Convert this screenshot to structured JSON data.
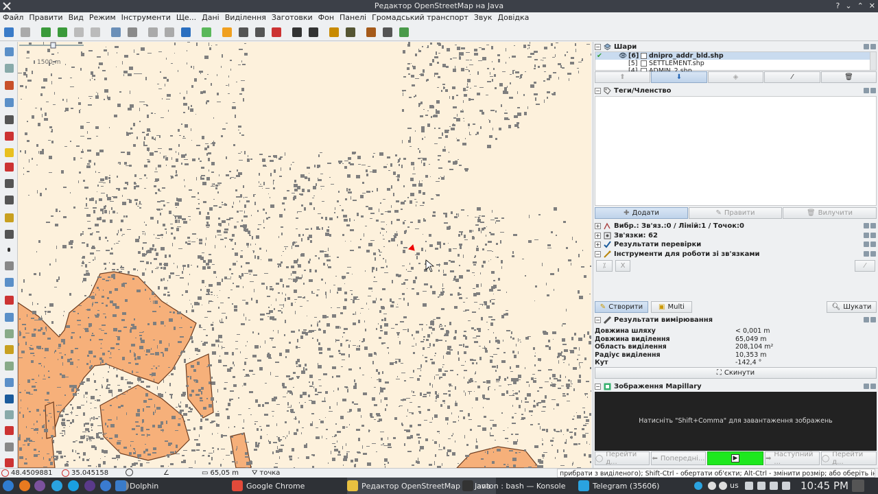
{
  "window": {
    "title": "Редактор OpenStreetMap на Java"
  },
  "menu": [
    "Файл",
    "Правити",
    "Вид",
    "Режим",
    "Інструменти",
    "Ще...",
    "Дані",
    "Виділення",
    "Заготовки",
    "Фон",
    "Панелі",
    "Громадський транспорт",
    "Звук",
    "Довідка"
  ],
  "colors": {
    "map_bg": "#fdf1dc",
    "building": "#7f7f7f",
    "settlement_fill": "#f6b07a",
    "settlement_stroke": "#6b3a1e",
    "panel_bg": "#eef0f2",
    "accent_green": "#1ee81e"
  },
  "toolbar_icons": [
    "open-icon",
    "save-icon",
    "download-icon",
    "upload-icon",
    "undo-icon",
    "redo-icon",
    "zoom-data-icon",
    "preferences-icon",
    "simplify-icon",
    "merge-icon",
    "refresh-icon",
    "bbox-icon",
    "preset-1-icon",
    "preset-2-icon",
    "preset-3-icon",
    "preset-4-icon",
    "car-icon",
    "bus-icon",
    "warning-icon",
    "restaurant-icon",
    "castle-icon",
    "industry-icon",
    "landuse-icon"
  ],
  "map": {
    "scale_label": "1500 m"
  },
  "layers": {
    "title": "Шари",
    "items": [
      {
        "index": "[6]",
        "name": "dnipro_addr_bld.shp",
        "active": true
      },
      {
        "index": "[5]",
        "name": "SETTLEMENT.shp",
        "active": false
      },
      {
        "index": "[4]",
        "name": "ADMIN_2.shp",
        "active": false
      }
    ]
  },
  "tags": {
    "title": "Теги/Членство",
    "add_label": "Додати",
    "edit_label": "Правити",
    "delete_label": "Вилучити"
  },
  "selection": {
    "title": "Вибр.: Зв'яз.:0 / Ліній:1 / Точок:0"
  },
  "relations": {
    "title": "Зв'язки: 62"
  },
  "validation": {
    "title": "Результати перевірки"
  },
  "relation_tools": {
    "title": "Інструменти для роботи зі зв'язками",
    "create_label": "Створити",
    "multi_label": "Multi",
    "search_label": "Шукати"
  },
  "measurement": {
    "title": "Результати вимірювання",
    "rows": [
      {
        "label": "Довжина шляху",
        "value": "< 0,001 m"
      },
      {
        "label": "Довжина виділення",
        "value": "65,049 m"
      },
      {
        "label": "Область виділення",
        "value": "208,104 m²"
      },
      {
        "label": "Радіус виділення",
        "value": "10,353 m"
      },
      {
        "label": "Кут",
        "value": "-142,4 °"
      }
    ],
    "reset_label": "Скинути"
  },
  "mapillary": {
    "title": "Зображення Mapillary",
    "message": "Натисніть \"Shift+Comma\" для завантаження зображень",
    "btn_goto_left": "Перейти д...",
    "btn_prev": "Попередні...",
    "btn_next": "Наступний ...",
    "btn_goto_right": "Перейти д..."
  },
  "status": {
    "lat": "48.4509881",
    "lon": "35.045158",
    "length": "65,05 m",
    "mode": "точка",
    "message": "прибрати з виділеного); Shift-Ctrl - обертати об'єкти; Alt-Ctrl - змінити розмір; або оберіть інший об'єкт"
  },
  "taskbar": {
    "apps": [
      {
        "label": "Dolphin"
      },
      {
        "label": "Google Chrome"
      },
      {
        "label": "Редактор OpenStreetMap на Java"
      },
      {
        "label": "anton : bash — Konsole"
      },
      {
        "label": "Telegram (35606)"
      }
    ],
    "keyboard_layout": "us",
    "clock": "10:45 PM"
  }
}
